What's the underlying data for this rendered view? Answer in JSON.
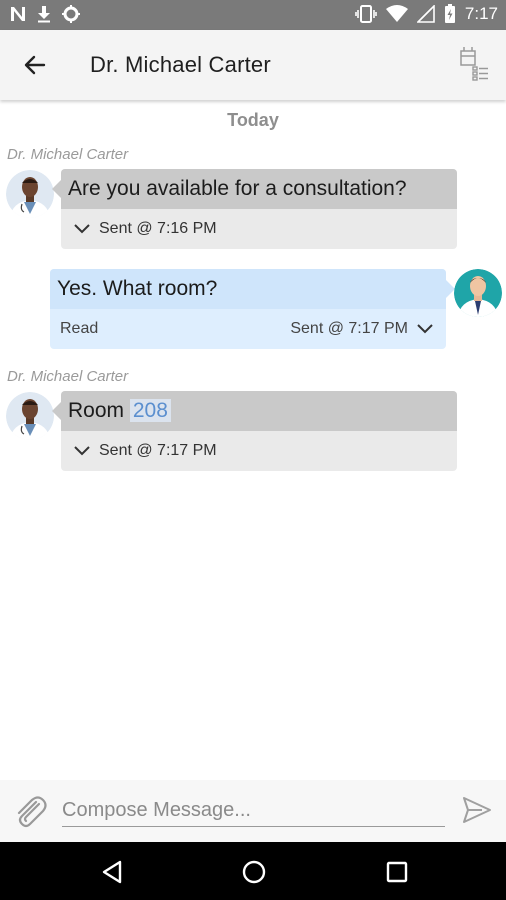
{
  "status_bar": {
    "time": "7:17",
    "left_icons": [
      "n-notification-icon",
      "download-icon",
      "settings-notification-icon"
    ],
    "right_icons": [
      "vibrate-icon",
      "wifi-icon",
      "signal-icon",
      "battery-icon"
    ]
  },
  "header": {
    "title": "Dr. Michael Carter",
    "back_icon": "arrow-left-icon",
    "details_icon": "conversation-details-icon"
  },
  "chat": {
    "date_separator": "Today",
    "messages": [
      {
        "direction": "incoming",
        "sender": "Dr. Michael Carter",
        "text": "Are you available for a consultation?",
        "status": "Sent @ 7:16 PM"
      },
      {
        "direction": "outgoing",
        "text": "Yes. What room?",
        "read_label": "Read",
        "status": "Sent @ 7:17 PM"
      },
      {
        "direction": "incoming",
        "sender": "Dr. Michael Carter",
        "text_prefix": "Room ",
        "text_link": "208",
        "status": "Sent @ 7:17 PM"
      }
    ]
  },
  "compose": {
    "placeholder": "Compose Message...",
    "value": "",
    "attach_icon": "paperclip-icon",
    "send_icon": "send-icon"
  },
  "nav_bar": {
    "icons": [
      "back-triangle-icon",
      "home-circle-icon",
      "recents-square-icon"
    ]
  },
  "colors": {
    "status_bar": "#7a7a7a",
    "app_bar": "#f4f4f4",
    "incoming_msg": "#c9c9c9",
    "incoming_meta": "#eaeaea",
    "outgoing_msg": "#cfe5fb",
    "outgoing_meta": "#deeefe",
    "link": "#5b8fcf"
  }
}
